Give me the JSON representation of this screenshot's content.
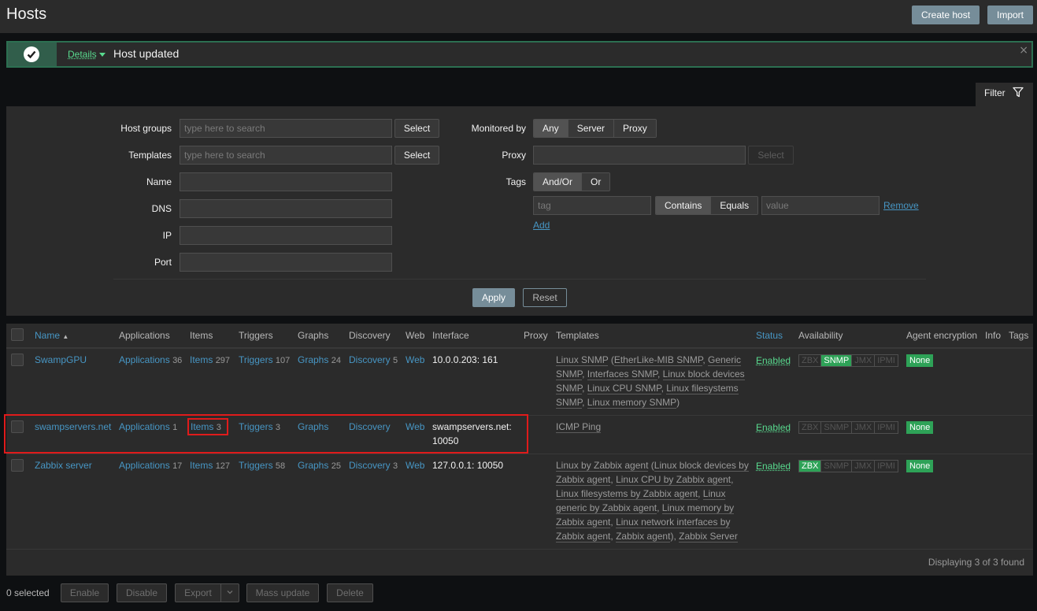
{
  "header": {
    "title": "Hosts",
    "create_host_label": "Create host",
    "import_label": "Import"
  },
  "message": {
    "details_label": "Details",
    "text": "Host updated",
    "close_glyph": "×",
    "icon": "check-circle-icon"
  },
  "filter": {
    "tab_label": "Filter",
    "tab_icon": "funnel-icon",
    "host_groups_label": "Host groups",
    "host_groups_placeholder": "type here to search",
    "templates_label": "Templates",
    "templates_placeholder": "type here to search",
    "select_label": "Select",
    "name_label": "Name",
    "dns_label": "DNS",
    "ip_label": "IP",
    "port_label": "Port",
    "monitored_by_label": "Monitored by",
    "monitored_by_options": [
      "Any",
      "Server",
      "Proxy"
    ],
    "proxy_label": "Proxy",
    "tags_label": "Tags",
    "tags_mode_options": [
      "And/Or",
      "Or"
    ],
    "tag_placeholder": "tag",
    "tag_op_options": [
      "Contains",
      "Equals"
    ],
    "value_placeholder": "value",
    "remove_label": "Remove",
    "add_label": "Add",
    "apply_label": "Apply",
    "reset_label": "Reset"
  },
  "table": {
    "columns": {
      "name": "Name",
      "applications": "Applications",
      "items": "Items",
      "triggers": "Triggers",
      "graphs": "Graphs",
      "discovery": "Discovery",
      "web": "Web",
      "interface": "Interface",
      "proxy": "Proxy",
      "templates": "Templates",
      "status": "Status",
      "availability": "Availability",
      "agent_encryption": "Agent encryption",
      "info": "Info",
      "tags": "Tags"
    },
    "rows": [
      {
        "name": "SwampGPU",
        "applications": "Applications",
        "applications_count": "36",
        "items": "Items",
        "items_count": "297",
        "triggers": "Triggers",
        "triggers_count": "107",
        "graphs": "Graphs",
        "graphs_count": "24",
        "discovery": "Discovery",
        "discovery_count": "5",
        "web": "Web",
        "interface": "10.0.0.203: 161",
        "status": "Enabled",
        "encryption": "None",
        "availability": [
          "ZBX",
          "SNMP",
          "JMX",
          "IPMI"
        ],
        "availability_on": "SNMP"
      },
      {
        "name": "swampservers.net",
        "applications": "Applications",
        "applications_count": "1",
        "items": "Items",
        "items_count": "3",
        "triggers": "Triggers",
        "triggers_count": "3",
        "graphs": "Graphs",
        "graphs_count": "",
        "discovery": "Discovery",
        "discovery_count": "",
        "web": "Web",
        "interface": "swampservers.net: 10050",
        "templates_text": "ICMP Ping",
        "status": "Enabled",
        "encryption": "None",
        "availability": [
          "ZBX",
          "SNMP",
          "JMX",
          "IPMI"
        ],
        "availability_on": ""
      },
      {
        "name": "Zabbix server",
        "applications": "Applications",
        "applications_count": "17",
        "items": "Items",
        "items_count": "127",
        "triggers": "Triggers",
        "triggers_count": "58",
        "graphs": "Graphs",
        "graphs_count": "25",
        "discovery": "Discovery",
        "discovery_count": "3",
        "web": "Web",
        "interface": "127.0.0.1: 10050",
        "status": "Enabled",
        "encryption": "None",
        "availability": [
          "ZBX",
          "SNMP",
          "JMX",
          "IPMI"
        ],
        "availability_on": "ZBX"
      }
    ],
    "row1_templates": {
      "t1": "Linux SNMP",
      "t1a": "EtherLike-MIB SNMP",
      "t1b": "Generic SNMP",
      "t1c": "Interfaces SNMP",
      "t1d": "Linux block devices SNMP",
      "t1e": "Linux CPU SNMP",
      "t1f": "Linux filesystems SNMP",
      "t1g": "Linux memory SNMP"
    },
    "row3_templates": {
      "t1": "Linux by Zabbix agent",
      "t1a": "Linux block devices by Zabbix agent",
      "t1b": "Linux CPU by Zabbix agent",
      "t1c": "Linux filesystems by Zabbix agent",
      "t1d": "Linux generic by Zabbix agent",
      "t1e": "Linux memory by Zabbix agent",
      "t1f": "Linux network interfaces by Zabbix agent",
      "t1g": "Zabbix agent",
      "t2": "Zabbix Server"
    },
    "displaying": "Displaying 3 of 3 found"
  },
  "actions": {
    "selected": "0 selected",
    "enable": "Enable",
    "disable": "Disable",
    "export": "Export",
    "mass_update": "Mass update",
    "delete": "Delete"
  }
}
